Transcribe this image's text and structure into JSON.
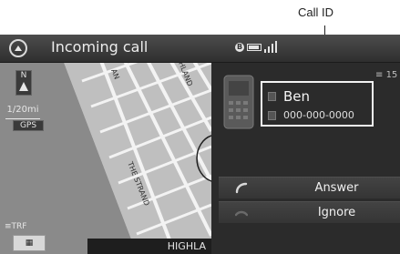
{
  "annotation": {
    "callout": "Call ID"
  },
  "header": {
    "title": "Incoming call",
    "home_icon": "home-icon",
    "status_icons": [
      "bluetooth-icon",
      "battery-icon",
      "signal-icon"
    ]
  },
  "map": {
    "scale": "1/20mi",
    "gps": "GPS",
    "compass_letter": "N",
    "traffic_label": "TRF",
    "traffic_button": "",
    "bottom_street": "HIGHLA",
    "street_names": [
      "THE STRAND",
      "HLAND",
      "AN"
    ]
  },
  "call": {
    "signal_value": "15",
    "caller": {
      "name": "Ben",
      "number": "000-000-0000"
    },
    "answer_label": "Answer",
    "ignore_label": "Ignore"
  },
  "colors": {
    "screen_bg": "#2a2a2a",
    "header_bg": "#3f3f3f",
    "text": "#f0f0f0",
    "highlight_border": "#f2f2f2"
  }
}
